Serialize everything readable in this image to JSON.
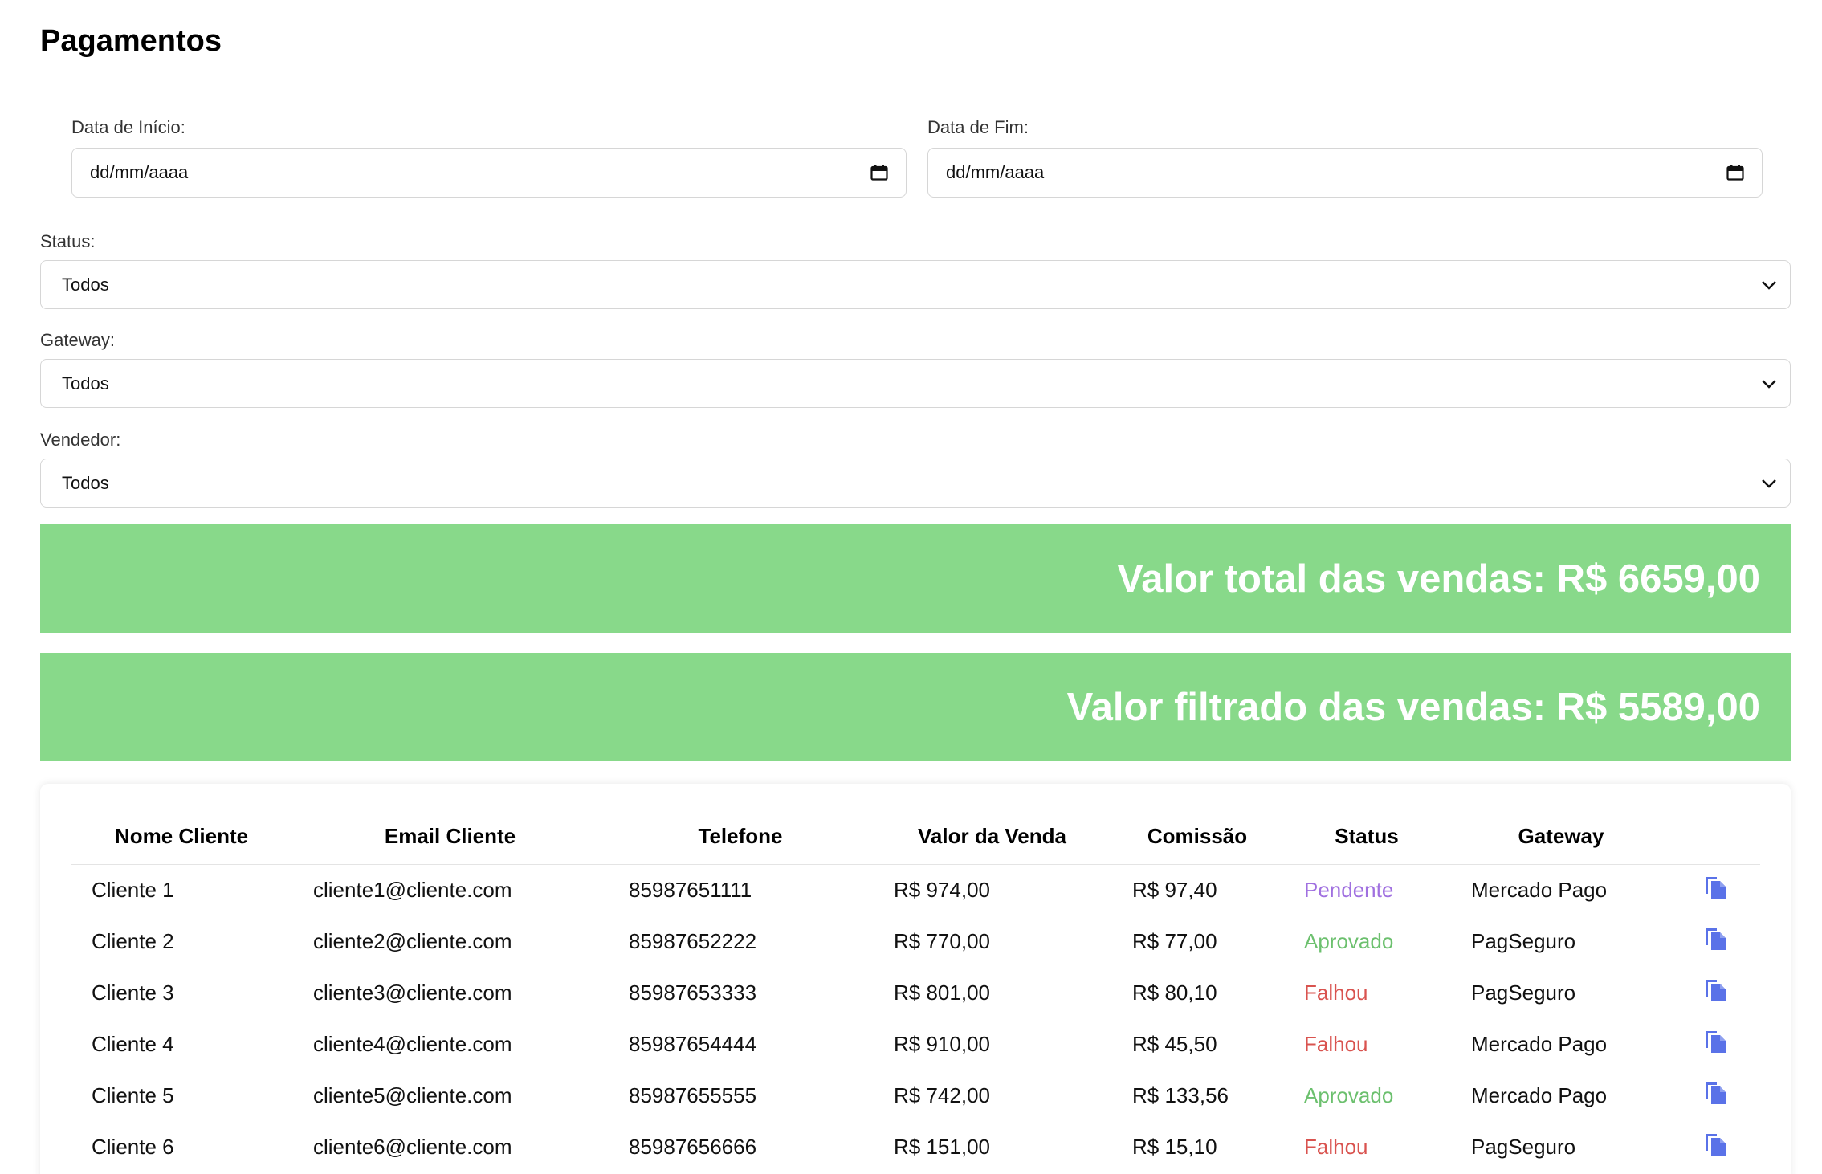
{
  "page": {
    "title": "Pagamentos"
  },
  "filters": {
    "start_date": {
      "label": "Data de Início:",
      "value": "dd/mm/aaaa"
    },
    "end_date": {
      "label": "Data de Fim:",
      "value": "dd/mm/aaaa"
    },
    "status": {
      "label": "Status:",
      "selected": "Todos"
    },
    "gateway": {
      "label": "Gateway:",
      "selected": "Todos"
    },
    "vendedor": {
      "label": "Vendedor:",
      "selected": "Todos"
    }
  },
  "summary": {
    "total": "Valor total das vendas: R$ 6659,00",
    "filtered": "Valor filtrado das vendas: R$ 5589,00",
    "color": "#88d98a"
  },
  "table": {
    "headers": [
      "Nome Cliente",
      "Email Cliente",
      "Telefone",
      "Valor da Venda",
      "Comissão",
      "Status",
      "Gateway",
      ""
    ],
    "rows": [
      {
        "name": "Cliente 1",
        "email": "cliente1@cliente.com",
        "phone": "85987651111",
        "value": "R$ 974,00",
        "commission": "R$ 97,40",
        "status": "Pendente",
        "gateway": "Mercado Pago"
      },
      {
        "name": "Cliente 2",
        "email": "cliente2@cliente.com",
        "phone": "85987652222",
        "value": "R$ 770,00",
        "commission": "R$ 77,00",
        "status": "Aprovado",
        "gateway": "PagSeguro"
      },
      {
        "name": "Cliente 3",
        "email": "cliente3@cliente.com",
        "phone": "85987653333",
        "value": "R$ 801,00",
        "commission": "R$ 80,10",
        "status": "Falhou",
        "gateway": "PagSeguro"
      },
      {
        "name": "Cliente 4",
        "email": "cliente4@cliente.com",
        "phone": "85987654444",
        "value": "R$ 910,00",
        "commission": "R$ 45,50",
        "status": "Falhou",
        "gateway": "Mercado Pago"
      },
      {
        "name": "Cliente 5",
        "email": "cliente5@cliente.com",
        "phone": "85987655555",
        "value": "R$ 742,00",
        "commission": "R$ 133,56",
        "status": "Aprovado",
        "gateway": "Mercado Pago"
      },
      {
        "name": "Cliente 6",
        "email": "cliente6@cliente.com",
        "phone": "85987656666",
        "value": "R$ 151,00",
        "commission": "R$ 15,10",
        "status": "Falhou",
        "gateway": "PagSeguro"
      }
    ],
    "status_colors": {
      "Pendente": "#a070e0",
      "Aprovado": "#6cc06e",
      "Falhou": "#d9534f"
    },
    "action_icon": "copy-icon"
  }
}
